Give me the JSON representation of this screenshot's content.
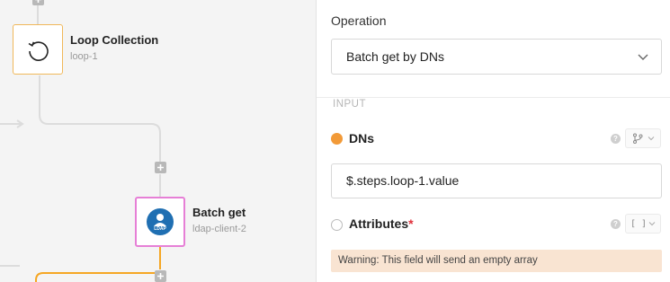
{
  "canvas": {
    "nodes": [
      {
        "title": "Loop Collection",
        "subtitle": "loop-1",
        "icon": "loop-icon",
        "border_color": "#f0b85a"
      },
      {
        "title": "Batch get",
        "subtitle": "ldap-client-2",
        "icon": "ldap-icon",
        "icon_text": "LDAP",
        "border_color": "#e67fd6"
      }
    ],
    "connector_color": "#dcdcdc",
    "active_connector_color": "#f5a623",
    "add_icon": "plus-icon"
  },
  "panel": {
    "operation_label": "Operation",
    "operation_value": "Batch get by DNs",
    "section_label": "INPUT",
    "fields": [
      {
        "label": "DNs",
        "required": false,
        "value": "$.steps.loop-1.value",
        "status": "filled",
        "status_color": "#f29a38",
        "mode_icon": "branch-icon"
      },
      {
        "label": "Attributes",
        "required": true,
        "required_mark": "*",
        "status": "empty",
        "mode_icon": "array-brackets-icon",
        "mode_glyph": "[ ]"
      }
    ],
    "help_glyph": "?",
    "warning": "Warning: This field will send an empty array"
  }
}
